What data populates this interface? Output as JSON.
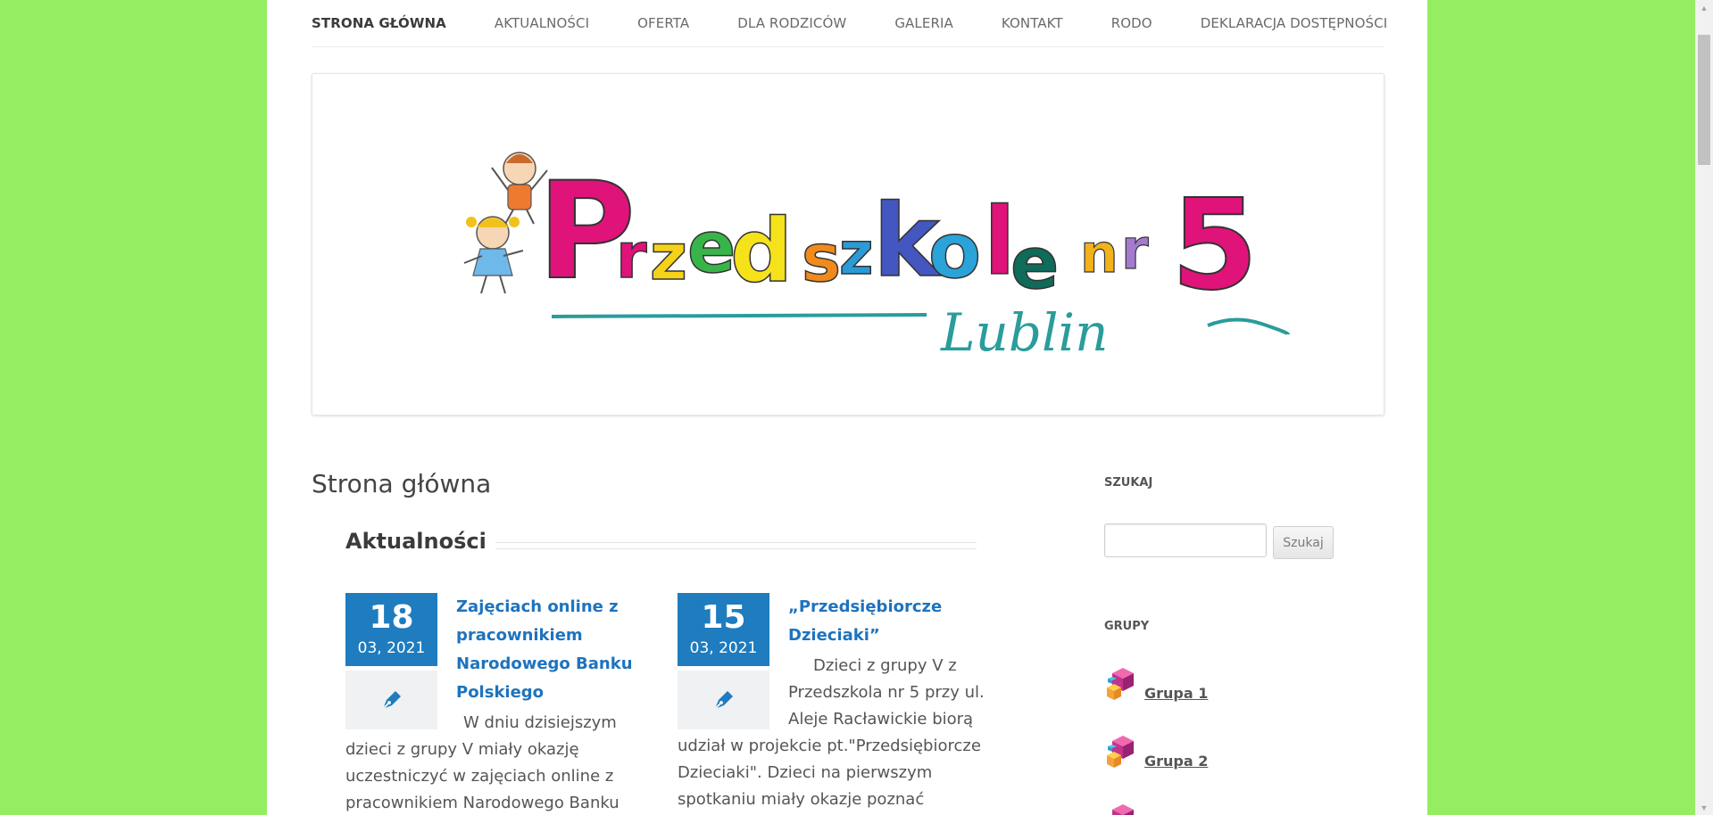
{
  "nav": {
    "items": [
      {
        "label": "STRONA GŁÓWNA",
        "active": true
      },
      {
        "label": "AKTUALNOŚCI"
      },
      {
        "label": "OFERTA"
      },
      {
        "label": "DLA RODZICÓW"
      },
      {
        "label": "GALERIA"
      },
      {
        "label": "KONTAKT"
      },
      {
        "label": "RODO"
      },
      {
        "label": "DEKLARACJA DOSTĘPNOŚCI"
      }
    ]
  },
  "banner": {
    "logo_letters": [
      "P",
      "r",
      "z",
      "e",
      "d",
      "s",
      "z",
      "k",
      "o",
      "l",
      "e",
      "n",
      "r",
      "5"
    ],
    "subtitle": "Lublin"
  },
  "main": {
    "page_title": "Strona główna",
    "section_title": "Aktualności",
    "posts": [
      {
        "day": "18",
        "month_year": "03, 2021",
        "format_icon": "pen-icon",
        "title": "Zajęciach online z pracownikiem Narodowego Banku Polskiego",
        "excerpt_lines": [
          "W dniu dzisiejszym",
          "dzieci z grupy V miały okazję",
          "uczestniczyć w zajęciach online z",
          "pracownikiem Narodowego Banku"
        ]
      },
      {
        "day": "15",
        "month_year": "03, 2021",
        "format_icon": "pen-icon",
        "title": "„Przedsiębiorcze Dzieciaki”",
        "excerpt_lines": [
          "Dzieci z grupy V z",
          "Przedszkola nr 5 przy ul.",
          "Aleje Racławickie biorą",
          "udział w projekcie pt.\"Przedsiębiorcze",
          "Dzieciaki\". Dzieci na pierwszym",
          "spotkaniu miały okazje poznać"
        ]
      }
    ]
  },
  "sidebar": {
    "search_title": "SZUKAJ",
    "search_placeholder": "",
    "search_button": "Szukaj",
    "groups_title": "GRUPY",
    "groups": [
      {
        "label": "Grupa 1",
        "icon": "cubes-icon"
      },
      {
        "label": "Grupa 2",
        "icon": "cubes-icon"
      }
    ]
  },
  "colors": {
    "background": "#95ed62",
    "accent": "#1e7cbf",
    "link": "#1e73be"
  }
}
